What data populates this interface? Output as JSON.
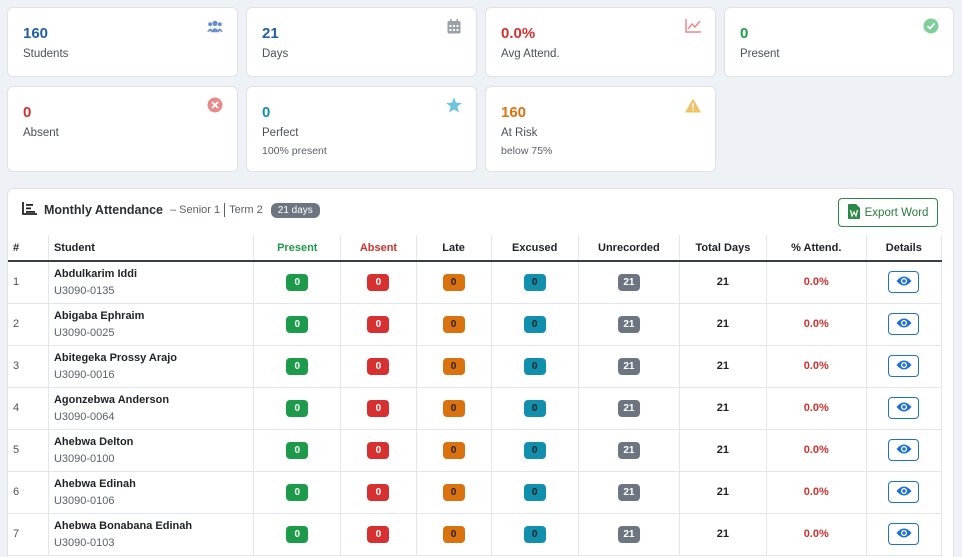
{
  "stats": [
    {
      "value": "160",
      "label": "Students",
      "sub": "",
      "color": "#1f5fa8",
      "icon": "users-icon"
    },
    {
      "value": "21",
      "label": "Days",
      "sub": "",
      "color": "#1f5fa8",
      "icon": "calendar-icon"
    },
    {
      "value": "0.0%",
      "label": "Avg Attend.",
      "sub": "",
      "color": "#d0312d",
      "icon": "line-chart-icon"
    },
    {
      "value": "0",
      "label": "Present",
      "sub": "",
      "color": "#1e9b4a",
      "icon": "check-circle-icon"
    },
    {
      "value": "0",
      "label": "Absent",
      "sub": "",
      "color": "#d0312d",
      "icon": "x-circle-icon"
    },
    {
      "value": "0",
      "label": "Perfect",
      "sub": "100% present",
      "color": "#128fad",
      "icon": "star-icon"
    },
    {
      "value": "160",
      "label": "At Risk",
      "sub": "below 75%",
      "color": "#d9720f",
      "icon": "warning-icon"
    }
  ],
  "panel": {
    "title": "Monthly Attendance",
    "class_label": "– Senior 1",
    "term_label": "Term 2",
    "days_badge": "21 days",
    "export_label": "Export Word"
  },
  "table": {
    "headers": {
      "index": "#",
      "student": "Student",
      "present": "Present",
      "absent": "Absent",
      "late": "Late",
      "excused": "Excused",
      "unrecorded": "Unrecorded",
      "total": "Total Days",
      "pct": "% Attend.",
      "details": "Details"
    },
    "rows": [
      {
        "idx": "1",
        "name": "Abdulkarim Iddi",
        "id": "U3090-0135",
        "present": "0",
        "absent": "0",
        "late": "0",
        "excused": "0",
        "unrecorded": "21",
        "total": "21",
        "pct": "0.0%"
      },
      {
        "idx": "2",
        "name": "Abigaba Ephraim",
        "id": "U3090-0025",
        "present": "0",
        "absent": "0",
        "late": "0",
        "excused": "0",
        "unrecorded": "21",
        "total": "21",
        "pct": "0.0%"
      },
      {
        "idx": "3",
        "name": "Abitegeka Prossy Arajo",
        "id": "U3090-0016",
        "present": "0",
        "absent": "0",
        "late": "0",
        "excused": "0",
        "unrecorded": "21",
        "total": "21",
        "pct": "0.0%"
      },
      {
        "idx": "4",
        "name": "Agonzebwa Anderson",
        "id": "U3090-0064",
        "present": "0",
        "absent": "0",
        "late": "0",
        "excused": "0",
        "unrecorded": "21",
        "total": "21",
        "pct": "0.0%"
      },
      {
        "idx": "5",
        "name": "Ahebwa Delton",
        "id": "U3090-0100",
        "present": "0",
        "absent": "0",
        "late": "0",
        "excused": "0",
        "unrecorded": "21",
        "total": "21",
        "pct": "0.0%"
      },
      {
        "idx": "6",
        "name": "Ahebwa Edinah",
        "id": "U3090-0106",
        "present": "0",
        "absent": "0",
        "late": "0",
        "excused": "0",
        "unrecorded": "21",
        "total": "21",
        "pct": "0.0%"
      },
      {
        "idx": "7",
        "name": "Ahebwa Bonabana Edinah",
        "id": "U3090-0103",
        "present": "0",
        "absent": "0",
        "late": "0",
        "excused": "0",
        "unrecorded": "21",
        "total": "21",
        "pct": "0.0%"
      }
    ]
  }
}
